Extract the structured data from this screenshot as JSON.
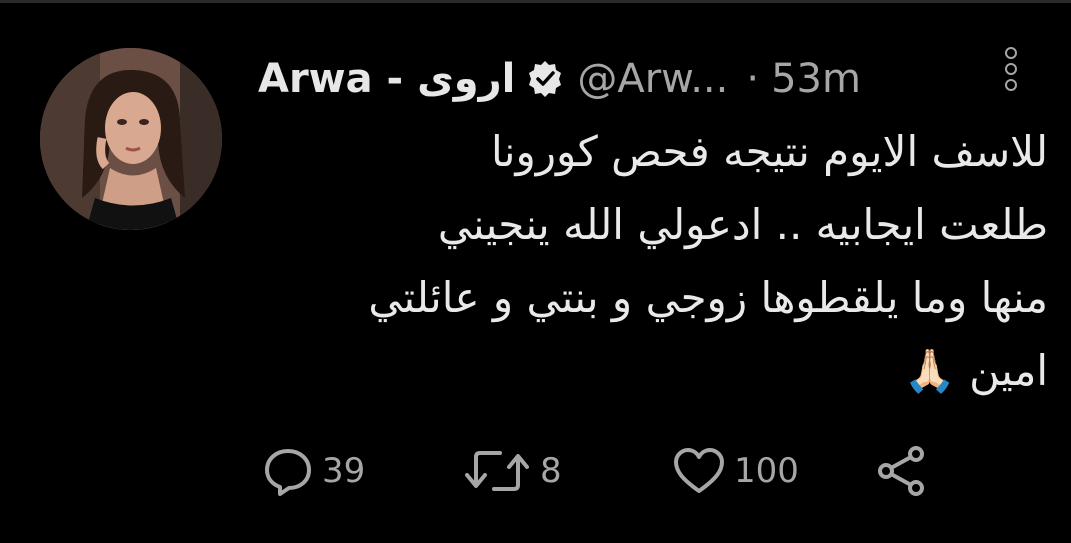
{
  "tweet": {
    "author_name": "Arwa - اروى",
    "handle": "@Arw...",
    "separator": "·",
    "time": "53m",
    "text_lines": [
      "للاسف الايوم نتيجه فحص كورونا",
      "طلعت ايجابيه .. ادعولي الله ينجيني",
      "منها وما يلقطوها زوجي و بنتي و عائلتي",
      "امين 🙏🏻"
    ]
  },
  "actions": {
    "reply_count": "39",
    "retweet_count": "8",
    "like_count": "100"
  },
  "icons": {
    "verified": "verified-badge-icon",
    "more": "more-vertical-icon",
    "reply": "reply-icon",
    "retweet": "retweet-icon",
    "like": "heart-icon",
    "share": "share-icon"
  },
  "colors": {
    "background": "#000000",
    "text": "#e9e9e9",
    "secondary": "#a6a6a6"
  }
}
